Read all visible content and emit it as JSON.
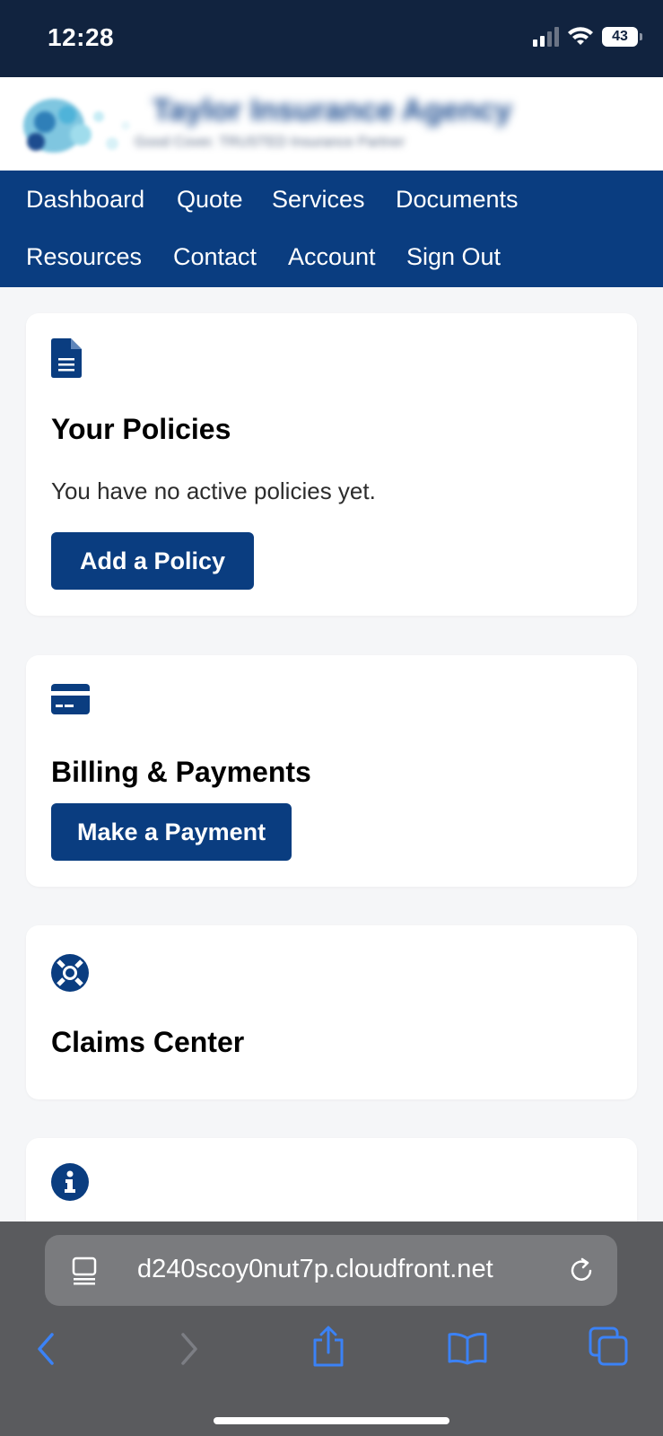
{
  "status_bar": {
    "time": "12:28",
    "battery": "43"
  },
  "header": {
    "brand_name": "Taylor Insurance Agency",
    "brand_sub": "Good Cover. TRUSTED Insurance Partner"
  },
  "nav": {
    "items": [
      {
        "label": "Dashboard"
      },
      {
        "label": "Quote"
      },
      {
        "label": "Services"
      },
      {
        "label": "Documents"
      },
      {
        "label": "Resources"
      },
      {
        "label": "Contact"
      },
      {
        "label": "Account"
      },
      {
        "label": "Sign Out"
      }
    ]
  },
  "cards": {
    "policies": {
      "icon": "document-icon",
      "title": "Your Policies",
      "text": "You have no active policies yet.",
      "button": "Add a Policy"
    },
    "billing": {
      "icon": "credit-card-icon",
      "title": "Billing & Payments",
      "button": "Make a Payment"
    },
    "claims": {
      "icon": "lifebuoy-icon",
      "title": "Claims Center"
    },
    "info": {
      "icon": "info-icon"
    }
  },
  "browser": {
    "url": "d240scoy0nut7p.cloudfront.net"
  },
  "colors": {
    "primary": "#0a3d80",
    "status_bar": "#11233f",
    "page_bg": "#f5f6f8",
    "browser_bar": "#5a5b5e",
    "browser_accent": "#3b82f6"
  }
}
